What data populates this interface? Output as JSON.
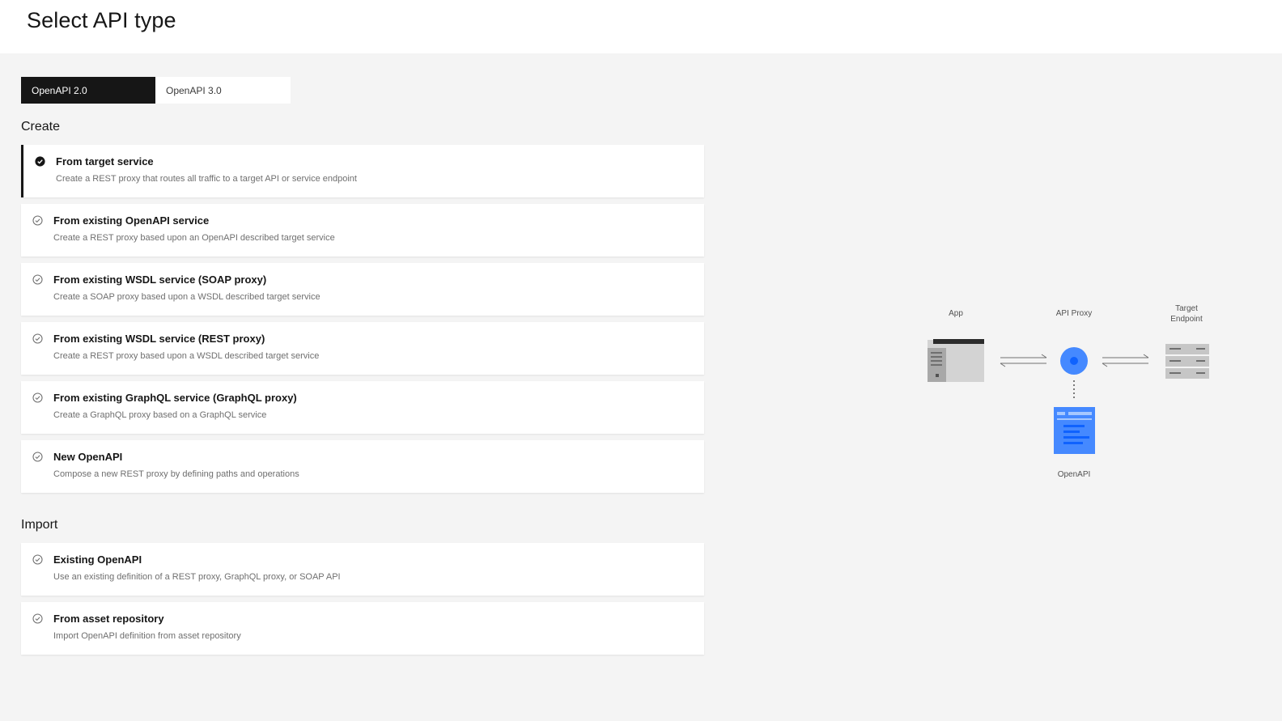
{
  "header": {
    "title": "Select API type"
  },
  "switcher": {
    "tabs": [
      {
        "label": "OpenAPI 2.0"
      },
      {
        "label": "OpenAPI 3.0"
      }
    ]
  },
  "create": {
    "heading": "Create",
    "options": [
      {
        "title": "From target service",
        "description": "Create a REST proxy that routes all traffic to a target API or service endpoint"
      },
      {
        "title": "From existing OpenAPI service",
        "description": "Create a REST proxy based upon an OpenAPI described target service"
      },
      {
        "title": "From existing WSDL service (SOAP proxy)",
        "description": "Create a SOAP proxy based upon a WSDL described target service"
      },
      {
        "title": "From existing WSDL service (REST proxy)",
        "description": "Create a REST proxy based upon a WSDL described target service"
      },
      {
        "title": "From existing GraphQL service (GraphQL proxy)",
        "description": "Create a GraphQL proxy based on a GraphQL service"
      },
      {
        "title": "New OpenAPI",
        "description": "Compose a new REST proxy by defining paths and operations"
      }
    ]
  },
  "import": {
    "heading": "Import",
    "options": [
      {
        "title": "Existing OpenAPI",
        "description": "Use an existing definition of a REST proxy, GraphQL proxy, or SOAP API"
      },
      {
        "title": "From asset repository",
        "description": "Import OpenAPI definition from asset repository"
      }
    ]
  },
  "diagram": {
    "app_label": "App",
    "proxy_label": "API Proxy",
    "target_label_line1": "Target",
    "target_label_line2": "Endpoint",
    "openapi_label": "OpenAPI"
  },
  "icons": {
    "selected_option": "checkmark-filled-icon",
    "unselected_option": "checkmark-outline-icon"
  },
  "colors": {
    "selected_tab": "#161616",
    "accent_blue": "#4589ff",
    "background": "#f4f4f4"
  }
}
